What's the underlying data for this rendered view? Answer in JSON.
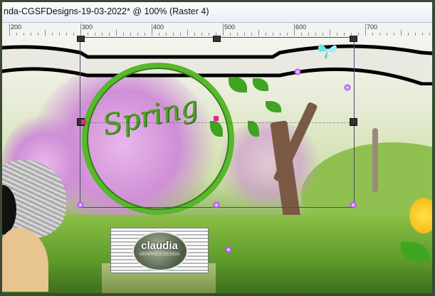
{
  "window": {
    "title": "nda-CGSFDesigns-19-03-2022* @ 100% (Raster 4)"
  },
  "ruler": {
    "labels": [
      "200",
      "300",
      "400",
      "500",
      "600",
      "700"
    ]
  },
  "canvas": {
    "artwork_text": "Spring",
    "logo_text": "claudia",
    "logo_subtext": "GRAPHICS DESIGN"
  },
  "colors": {
    "ring": "#58b82b",
    "selection_handle": "#333333",
    "handle_accent": "#e02a8a"
  }
}
